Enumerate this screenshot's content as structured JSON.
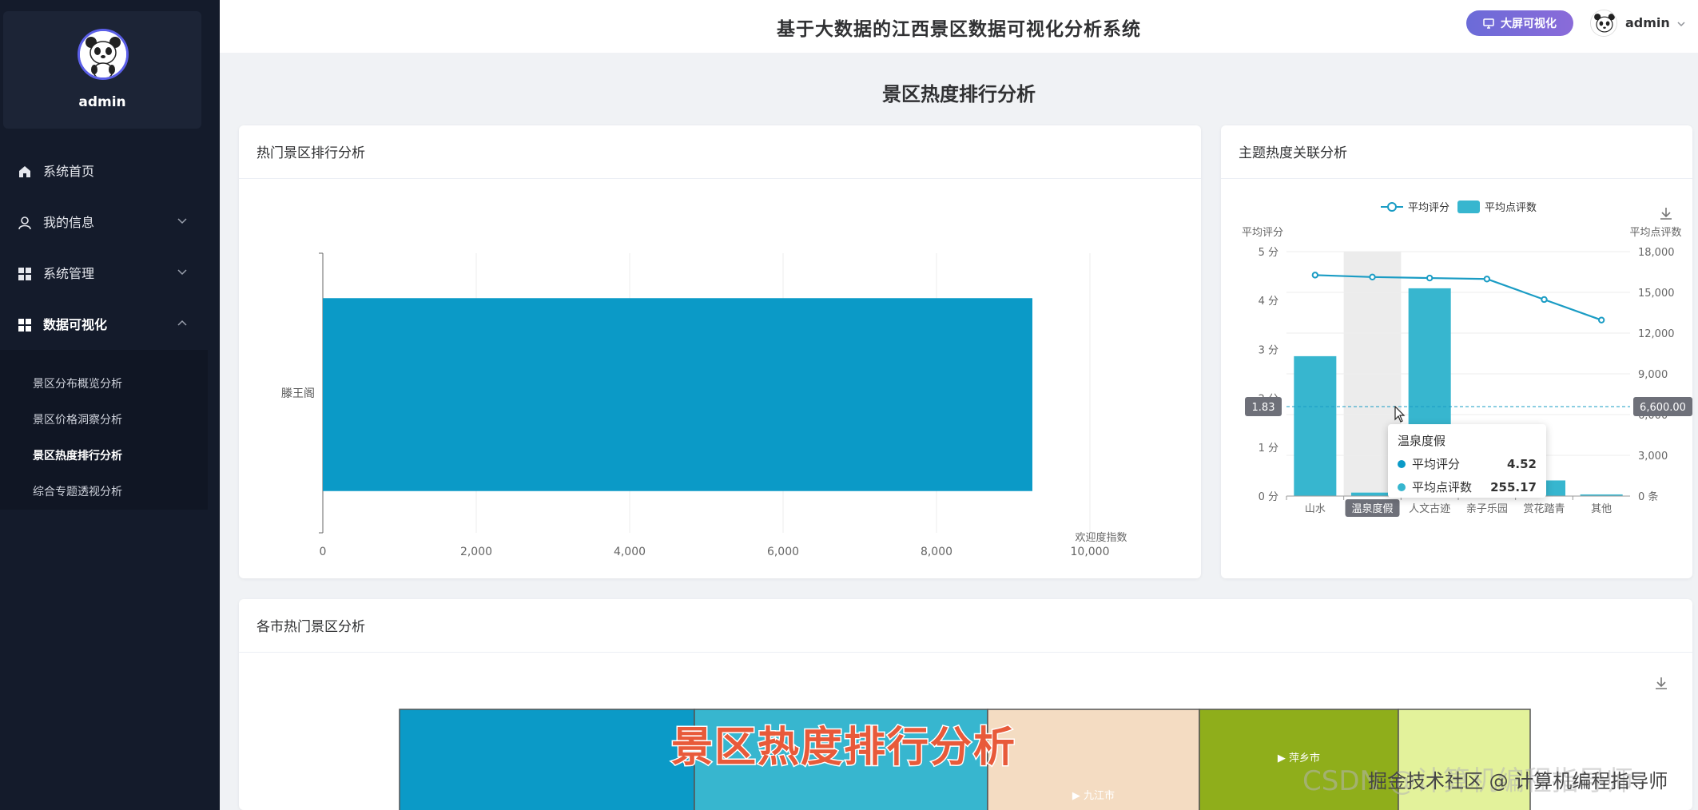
{
  "sidebar": {
    "username": "admin",
    "nav": [
      {
        "label": "系统首页",
        "icon": "home-icon"
      },
      {
        "label": "我的信息",
        "icon": "user-icon"
      },
      {
        "label": "系统管理",
        "icon": "grid-icon"
      },
      {
        "label": "数据可视化",
        "icon": "grid-icon"
      }
    ],
    "submenu": [
      {
        "label": "景区分布概览分析",
        "active": false
      },
      {
        "label": "景区价格洞察分析",
        "active": false
      },
      {
        "label": "景区热度排行分析",
        "active": true
      },
      {
        "label": "综合专题透视分析",
        "active": false
      }
    ]
  },
  "header": {
    "title": "基于大数据的江西景区数据可视化分析系统",
    "bigscreen_label": "大屏可视化",
    "username": "admin"
  },
  "page_title": "景区热度排行分析",
  "cards": {
    "hot": {
      "title": "热门景区排行分析"
    },
    "theme": {
      "title": "主题热度关联分析"
    },
    "city": {
      "title": "各市热门景区分析"
    }
  },
  "tooltip": {
    "category": "温泉度假",
    "rows": [
      {
        "name": "平均评分",
        "value": "4.52",
        "color": "#0b9ac7"
      },
      {
        "name": "平均点评数",
        "value": "255.17",
        "color": "#37b6cf"
      }
    ]
  },
  "chart_data": [
    {
      "type": "bar",
      "orientation": "horizontal",
      "categories": [
        "滕王阁"
      ],
      "values": [
        9250
      ],
      "xlabel": "欢迎度指数",
      "xlim": [
        0,
        10000
      ],
      "xticks": [
        "0",
        "2,000",
        "4,000",
        "6,000",
        "8,000",
        "10,000"
      ],
      "color": "#0b9ac7"
    },
    {
      "type": "bar",
      "categories": [
        "山水",
        "温泉度假",
        "人文古迹",
        "亲子乐园",
        "赏花踏青",
        "其他"
      ],
      "series": [
        {
          "name": "平均评分",
          "type": "line",
          "values": [
            4.52,
            4.48,
            4.46,
            4.44,
            4.02,
            3.6
          ],
          "color": "#1a9cc4"
        },
        {
          "name": "平均点评数",
          "type": "bar",
          "values": [
            10300,
            255.17,
            15300,
            1150,
            1150,
            120
          ],
          "color": "#37b6cf"
        }
      ],
      "y_left": {
        "label": "平均评分",
        "ylim": [
          0,
          5
        ],
        "ticks": [
          "0 分",
          "1 分",
          "2 分",
          "3 分",
          "4 分",
          "5 分"
        ]
      },
      "y_right": {
        "label": "平均点评数",
        "ylim": [
          0,
          18000
        ],
        "ticks": [
          "0 条",
          "3,000",
          "6,000",
          "9,000",
          "12,000",
          "15,000",
          "18,000"
        ]
      },
      "axis_pointer": {
        "left": "1.83",
        "right": "6,600.00"
      },
      "legend": "top-center"
    },
    {
      "type": "treemap",
      "cells": [
        {
          "label": "",
          "color": "#0b9ac7"
        },
        {
          "label": "",
          "color": "#37b6cf"
        },
        {
          "label": "▶ 九江市",
          "color": "#f4dcc2"
        },
        {
          "label": "▶ 萍乡市",
          "color": "#8fae1b"
        },
        {
          "label": "",
          "color": "#e3f29b"
        }
      ]
    }
  ],
  "overlay": {
    "caption": "景区热度排行分析",
    "watermark": "CSDN @计算机编程指导师",
    "watermark_front": "掘金技术社区 @ 计算机编程指导师"
  }
}
